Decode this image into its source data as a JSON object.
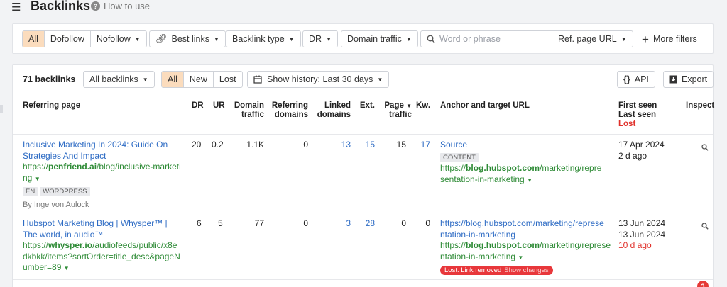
{
  "header": {
    "title": "Backlinks",
    "how_to_use": "How to use"
  },
  "filters": {
    "link_type_tabs": [
      "All",
      "Dofollow",
      "Nofollow"
    ],
    "best_links": "Best links",
    "backlink_type": "Backlink type",
    "dr": "DR",
    "domain_traffic": "Domain traffic",
    "search_placeholder": "Word or phrase",
    "ref_page_url": "Ref. page URL",
    "more_filters": "More filters"
  },
  "toolbar": {
    "count": "71 backlinks",
    "all_backlinks": "All backlinks",
    "status_tabs": [
      "All",
      "New",
      "Lost"
    ],
    "show_history": "Show history: Last 30 days",
    "api": "API",
    "export": "Export"
  },
  "columns": {
    "referring_page": "Referring page",
    "dr": "DR",
    "ur": "UR",
    "domain_traffic": [
      "Domain",
      "traffic"
    ],
    "referring_domains": [
      "Referring",
      "domains"
    ],
    "linked_domains": [
      "Linked",
      "domains"
    ],
    "ext": "Ext.",
    "page_traffic": [
      "Page",
      "traffic"
    ],
    "kw": "Kw.",
    "anchor": "Anchor and target URL",
    "first_seen": "First seen",
    "last_seen": "Last seen",
    "lost": "Lost",
    "inspect": "Inspect"
  },
  "rows": [
    {
      "title": [
        "Inclusive Marketing In 2024: Guide On",
        "Strategies And Impact"
      ],
      "url_prefix": "https://",
      "url_domain": "penfriend.ai",
      "url_rest": "/blog/inclusive-marketi",
      "url_rest2": "ng",
      "tags": [
        "EN",
        "WORDPRESS"
      ],
      "author": "By Inge von Aulock",
      "dr": "20",
      "ur": "0.2",
      "domain_traffic": "1.1K",
      "referring_domains": "0",
      "linked_domains": "13",
      "ext": "15",
      "page_traffic": "15",
      "kw": "17",
      "anchor_text": "Source",
      "anchor_tag": "CONTENT",
      "target_prefix": "https://",
      "target_domain": "blog.hubspot.com",
      "target_rest": "/marketing/repre",
      "target_rest2": "sentation-in-marketing",
      "first_seen": "17 Apr 2024",
      "last_seen": "2 d ago"
    },
    {
      "title": [
        "Hubspot Marketing Blog | Whysper™ |",
        "The world, in audio™"
      ],
      "url_prefix": "https://",
      "url_domain": "whysper.io",
      "url_rest": "/audiofeeds/public/x8e",
      "url_rest2": "dkbkk/items?sortOrder=title_desc&pageN",
      "url_rest3": "umber=89",
      "dr": "6",
      "ur": "5",
      "domain_traffic": "77",
      "referring_domains": "0",
      "linked_domains": "3",
      "ext": "28",
      "page_traffic": "0",
      "kw": "0",
      "anchor_text": [
        "https://blog.hubspot.com/marketing/represe",
        "ntation-in-marketing"
      ],
      "target_prefix": "https://",
      "target_domain": "blog.hubspot.com",
      "target_rest": "/marketing/represe",
      "target_rest2": "ntation-in-marketing",
      "lost_badge": "Lost: Link removed",
      "show_changes": "Show changes",
      "first_seen": "13 Jun 2024",
      "last_seen": "13 Jun 2024",
      "lost_ago": "10 d ago"
    }
  ],
  "notification_count": "3"
}
